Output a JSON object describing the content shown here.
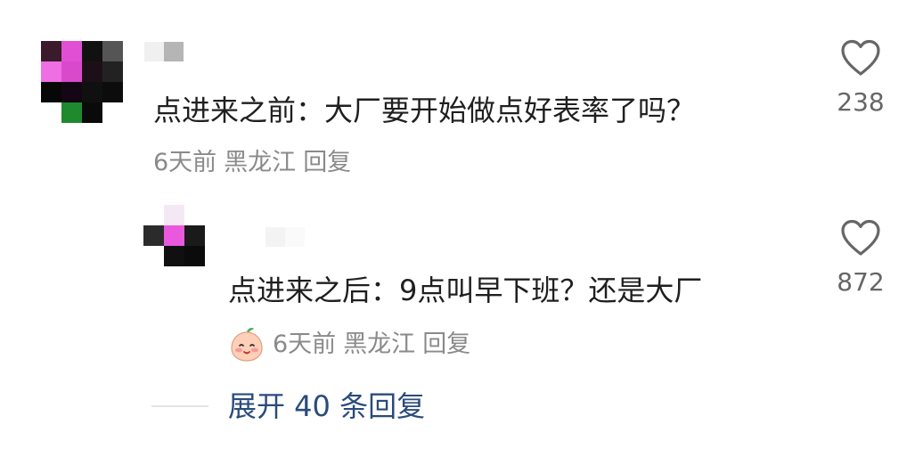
{
  "comments": [
    {
      "text": "点进来之前：大厂要开始做点好表率了吗？",
      "time": "6天前",
      "location": "黑龙江",
      "reply_label": "回复",
      "likes": "238",
      "avatar_colors": [
        [
          "#3a1a2b",
          "#e04fd4",
          "#111111",
          "#555555"
        ],
        [
          "#ef6ee3",
          "#d94acb",
          "#1d0f18",
          "#222222"
        ],
        [
          "#070707",
          "#140612",
          "#101010",
          "#0c0c0c"
        ],
        [
          "#ffffff",
          "#1f8a2d",
          "#0a0a0a",
          "#ffffff"
        ]
      ]
    }
  ],
  "reply": {
    "text": "点进来之后：9点叫早下班？还是大厂",
    "time": "6天前",
    "location": "黑龙江",
    "reply_label": "回复",
    "likes": "872",
    "avatar_colors": [
      [
        "#ffffff",
        "#f5e8f5",
        "#ffffff"
      ],
      [
        "#2b2b2b",
        "#ea58de",
        "#1a1a1a"
      ],
      [
        "#ffffff",
        "#101010",
        "#0b0b0b"
      ]
    ]
  },
  "expand": {
    "label": "展开 40 条回复"
  },
  "icons": {
    "like": "heart-outline-icon",
    "sticker": "peach-face-icon"
  }
}
